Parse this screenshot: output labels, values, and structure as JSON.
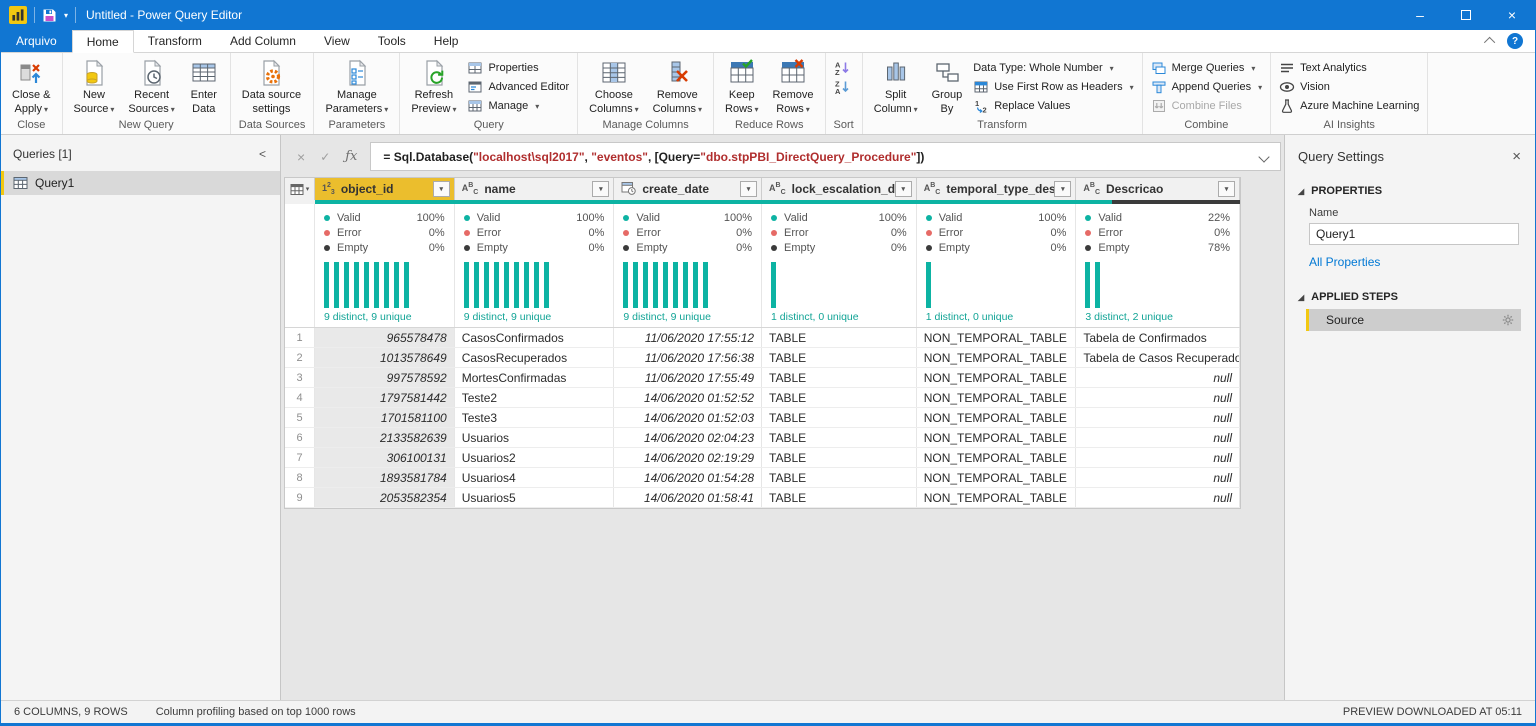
{
  "title_bar": {
    "title": "Untitled - Power Query Editor"
  },
  "menu": {
    "file_tab": "Arquivo",
    "tabs": [
      "Home",
      "Transform",
      "Add Column",
      "View",
      "Tools",
      "Help"
    ],
    "active_tab": "Home"
  },
  "ribbon": {
    "groups": [
      {
        "label": "Close",
        "items": [
          {
            "kind": "big",
            "name": "close-apply",
            "icon": "close-apply",
            "lines": [
              "Close &",
              "Apply"
            ],
            "dropdown": true
          }
        ]
      },
      {
        "label": "New Query",
        "items": [
          {
            "kind": "big",
            "name": "new-source",
            "icon": "new-source",
            "lines": [
              "New",
              "Source"
            ],
            "dropdown": true
          },
          {
            "kind": "big",
            "name": "recent-sources",
            "icon": "recent-sources",
            "lines": [
              "Recent",
              "Sources"
            ],
            "dropdown": true
          },
          {
            "kind": "big",
            "name": "enter-data",
            "icon": "enter-data",
            "lines": [
              "Enter",
              "Data"
            ]
          }
        ]
      },
      {
        "label": "Data Sources",
        "items": [
          {
            "kind": "big",
            "name": "data-source-settings",
            "icon": "data-source-settings",
            "lines": [
              "Data source",
              "settings"
            ]
          }
        ]
      },
      {
        "label": "Parameters",
        "items": [
          {
            "kind": "big",
            "name": "manage-parameters",
            "icon": "manage-parameters",
            "lines": [
              "Manage",
              "Parameters"
            ],
            "dropdown": true
          }
        ]
      },
      {
        "label": "Query",
        "items": [
          {
            "kind": "big",
            "name": "refresh-preview",
            "icon": "refresh-preview",
            "lines": [
              "Refresh",
              "Preview"
            ],
            "dropdown": true
          },
          {
            "kind": "stack",
            "buttons": [
              {
                "name": "properties",
                "icon": "properties",
                "label": "Properties"
              },
              {
                "name": "advanced-editor",
                "icon": "advanced-editor",
                "label": "Advanced Editor"
              },
              {
                "name": "manage",
                "icon": "manage",
                "label": "Manage",
                "dropdown": true
              }
            ]
          }
        ]
      },
      {
        "label": "Manage Columns",
        "items": [
          {
            "kind": "big",
            "name": "choose-columns",
            "icon": "choose-columns",
            "lines": [
              "Choose",
              "Columns"
            ],
            "dropdown": true
          },
          {
            "kind": "big",
            "name": "remove-columns",
            "icon": "remove-columns",
            "lines": [
              "Remove",
              "Columns"
            ],
            "dropdown": true
          }
        ]
      },
      {
        "label": "Reduce Rows",
        "items": [
          {
            "kind": "big",
            "name": "keep-rows",
            "icon": "keep-rows",
            "lines": [
              "Keep",
              "Rows"
            ],
            "dropdown": true
          },
          {
            "kind": "big",
            "name": "remove-rows",
            "icon": "remove-rows",
            "lines": [
              "Remove",
              "Rows"
            ],
            "dropdown": true
          }
        ]
      },
      {
        "label": "Sort",
        "items": [
          {
            "kind": "stack",
            "buttons": [
              {
                "name": "sort-ascending",
                "icon": "sort-az",
                "label": ""
              },
              {
                "name": "sort-descending",
                "icon": "sort-za",
                "label": ""
              }
            ]
          }
        ]
      },
      {
        "label": "Transform",
        "items": [
          {
            "kind": "big",
            "name": "split-column",
            "icon": "split-column",
            "lines": [
              "Split",
              "Column"
            ],
            "dropdown": true
          },
          {
            "kind": "big",
            "name": "group-by",
            "icon": "group-by",
            "lines": [
              "Group",
              "By"
            ]
          },
          {
            "kind": "stack",
            "buttons": [
              {
                "name": "data-type",
                "label": "Data Type: Whole Number",
                "dropdown": true
              },
              {
                "name": "use-first-row-as-headers",
                "icon": "first-row-headers",
                "label": "Use First Row as Headers",
                "dropdown": true
              },
              {
                "name": "replace-values",
                "icon": "replace-values",
                "label": "Replace Values"
              }
            ]
          }
        ]
      },
      {
        "label": "Combine",
        "items": [
          {
            "kind": "stack",
            "buttons": [
              {
                "name": "merge-queries",
                "icon": "merge-queries",
                "label": "Merge Queries",
                "dropdown": true
              },
              {
                "name": "append-queries",
                "icon": "append-queries",
                "label": "Append Queries",
                "dropdown": true
              },
              {
                "name": "combine-files",
                "icon": "combine-files",
                "label": "Combine Files",
                "disabled": true
              }
            ]
          }
        ]
      },
      {
        "label": "AI Insights",
        "items": [
          {
            "kind": "stack",
            "buttons": [
              {
                "name": "text-analytics",
                "icon": "text-analytics",
                "label": "Text Analytics"
              },
              {
                "name": "vision",
                "icon": "vision",
                "label": "Vision"
              },
              {
                "name": "azure-machine-learning",
                "icon": "azure-ml",
                "label": "Azure Machine Learning"
              }
            ]
          }
        ]
      }
    ]
  },
  "queries_panel": {
    "title": "Queries [1]",
    "items": [
      {
        "label": "Query1",
        "selected": true
      }
    ]
  },
  "formula_bar": {
    "segments": [
      {
        "text": "= Sql.Database(",
        "kind": "plain"
      },
      {
        "text": "\"localhost\\sql2017\"",
        "kind": "string"
      },
      {
        "text": ", ",
        "kind": "plain"
      },
      {
        "text": "\"eventos\"",
        "kind": "string"
      },
      {
        "text": ", [Query=",
        "kind": "plain"
      },
      {
        "text": "\"dbo.stpPBI_DirectQuery_Procedure\"",
        "kind": "string"
      },
      {
        "text": "])",
        "kind": "plain"
      }
    ]
  },
  "table": {
    "profile_labels": {
      "valid": "Valid",
      "error": "Error",
      "empty": "Empty"
    },
    "columns": [
      {
        "name": "object_id",
        "type": "number",
        "selected": true,
        "valid_pct": 100,
        "error_pct": 0,
        "empty_pct": 0,
        "hist_bars": 9,
        "distinct_label": "9 distinct, 9 unique"
      },
      {
        "name": "name",
        "type": "text",
        "selected": false,
        "valid_pct": 100,
        "error_pct": 0,
        "empty_pct": 0,
        "hist_bars": 9,
        "distinct_label": "9 distinct, 9 unique"
      },
      {
        "name": "create_date",
        "type": "datetime",
        "selected": false,
        "valid_pct": 100,
        "error_pct": 0,
        "empty_pct": 0,
        "hist_bars": 9,
        "distinct_label": "9 distinct, 9 unique"
      },
      {
        "name": "lock_escalation_desc",
        "type": "text",
        "selected": false,
        "valid_pct": 100,
        "error_pct": 0,
        "empty_pct": 0,
        "hist_bars": 1,
        "distinct_label": "1 distinct, 0 unique"
      },
      {
        "name": "temporal_type_desc",
        "type": "text",
        "selected": false,
        "valid_pct": 100,
        "error_pct": 0,
        "empty_pct": 0,
        "hist_bars": 1,
        "distinct_label": "1 distinct, 0 unique"
      },
      {
        "name": "Descricao",
        "type": "text",
        "selected": false,
        "valid_pct": 22,
        "error_pct": 0,
        "empty_pct": 78,
        "hist_bars": 2,
        "distinct_label": "3 distinct, 2 unique"
      }
    ],
    "rows": [
      [
        "965578478",
        "CasosConfirmados",
        "11/06/2020 17:55:12",
        "TABLE",
        "NON_TEMPORAL_TABLE",
        "Tabela de Confirmados"
      ],
      [
        "1013578649",
        "CasosRecuperados",
        "11/06/2020 17:56:38",
        "TABLE",
        "NON_TEMPORAL_TABLE",
        "Tabela de Casos Recuperados"
      ],
      [
        "997578592",
        "MortesConfirmadas",
        "11/06/2020 17:55:49",
        "TABLE",
        "NON_TEMPORAL_TABLE",
        "null"
      ],
      [
        "1797581442",
        "Teste2",
        "14/06/2020 01:52:52",
        "TABLE",
        "NON_TEMPORAL_TABLE",
        "null"
      ],
      [
        "1701581100",
        "Teste3",
        "14/06/2020 01:52:03",
        "TABLE",
        "NON_TEMPORAL_TABLE",
        "null"
      ],
      [
        "2133582639",
        "Usuarios",
        "14/06/2020 02:04:23",
        "TABLE",
        "NON_TEMPORAL_TABLE",
        "null"
      ],
      [
        "306100131",
        "Usuarios2",
        "14/06/2020 02:19:29",
        "TABLE",
        "NON_TEMPORAL_TABLE",
        "null"
      ],
      [
        "1893581784",
        "Usuarios4",
        "14/06/2020 01:54:28",
        "TABLE",
        "NON_TEMPORAL_TABLE",
        "null"
      ],
      [
        "2053582354",
        "Usuarios5",
        "14/06/2020 01:58:41",
        "TABLE",
        "NON_TEMPORAL_TABLE",
        "null"
      ]
    ]
  },
  "query_settings": {
    "title": "Query Settings",
    "properties_title": "PROPERTIES",
    "name_label": "Name",
    "name_value": "Query1",
    "all_properties_label": "All Properties",
    "applied_steps_title": "APPLIED STEPS",
    "steps": [
      {
        "label": "Source",
        "selected": true,
        "has_settings": true
      }
    ]
  },
  "status_bar": {
    "columns_rows": "6 COLUMNS, 9 ROWS",
    "profiling_note": "Column profiling based on top 1000 rows",
    "preview_downloaded": "PREVIEW DOWNLOADED AT 05:11"
  },
  "colors": {
    "accent_blue": "#1176D2",
    "power_bi_yellow": "#F2C811",
    "teal": "#0DB3A3",
    "error_red": "#E66A66",
    "empty_dark": "#3B3B3B",
    "selected_header_gold": "#EBBE2D",
    "link_blue": "#0078D4",
    "string_red": "#B02E2E"
  }
}
